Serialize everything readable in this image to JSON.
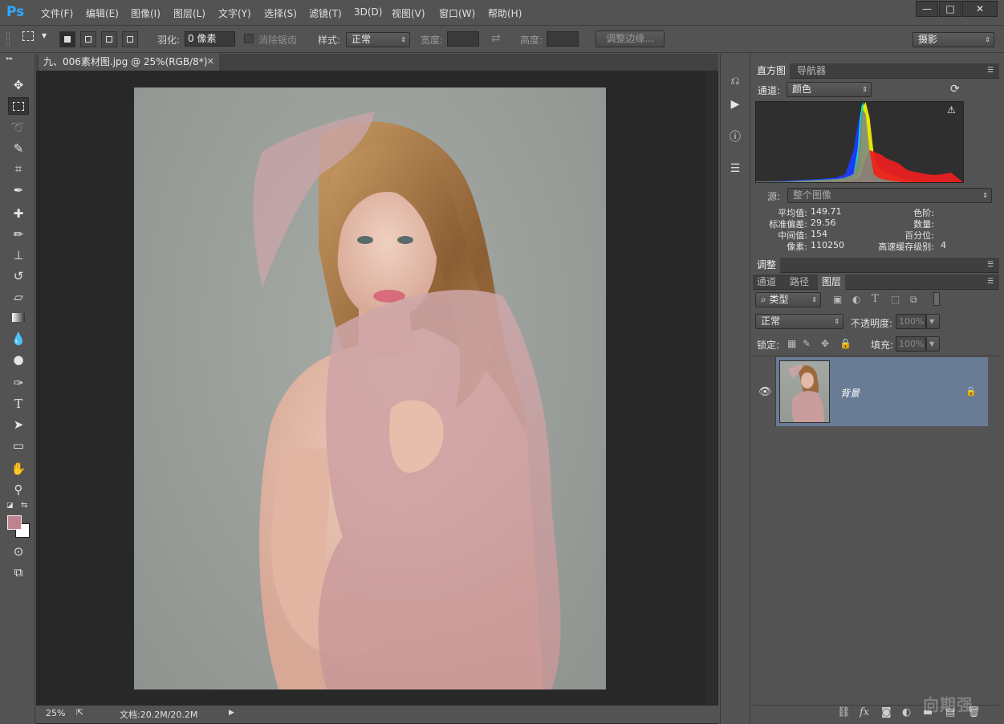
{
  "app": {
    "logo": "Ps"
  },
  "menu": [
    "文件(F)",
    "编辑(E)",
    "图像(I)",
    "图层(L)",
    "文字(Y)",
    "选择(S)",
    "滤镜(T)",
    "3D(D)",
    "视图(V)",
    "窗口(W)",
    "帮助(H)"
  ],
  "window_controls": {
    "minimize": "—",
    "maximize": "□",
    "close": "✕"
  },
  "options": {
    "feather_label": "羽化:",
    "feather_value": "0 像素",
    "antialias_label": "消除锯齿",
    "style_label": "样式:",
    "style_value": "正常",
    "width_label": "宽度:",
    "height_label": "高度:",
    "refine_edge": "调整边缘...",
    "workspace": "摄影"
  },
  "document": {
    "tab_title": "九、006素材图.jpg @ 25%(RGB/8*)",
    "zoom": "25%",
    "doc_size": "文档:20.2M/20.2M"
  },
  "colors": {
    "foreground": "#c1828f",
    "background": "#ffffff",
    "layer_selected": "#6a7b96"
  },
  "histogram": {
    "tabs": [
      "直方图",
      "导航器"
    ],
    "channel_label": "通道:",
    "channel_value": "颜色",
    "source_label": "源:",
    "source_value": "整个图像",
    "stats_left": [
      {
        "label": "平均值:",
        "value": "149.71"
      },
      {
        "label": "标准偏差:",
        "value": "29.56"
      },
      {
        "label": "中间值:",
        "value": "154"
      },
      {
        "label": "像素:",
        "value": "110250"
      }
    ],
    "stats_right": [
      {
        "label": "色阶:",
        "value": ""
      },
      {
        "label": "数量:",
        "value": ""
      },
      {
        "label": "百分位:",
        "value": ""
      },
      {
        "label": "高速缓存级别:",
        "value": "4"
      }
    ]
  },
  "adjustments": {
    "tab": "调整"
  },
  "layers_panel": {
    "tabs": [
      "通道",
      "路径",
      "图层"
    ],
    "filter_value": "类型",
    "blend_value": "正常",
    "opacity_label": "不透明度:",
    "opacity_value": "100%",
    "lock_label": "锁定:",
    "fill_label": "填充:",
    "fill_value": "100%",
    "layer_name": "背景"
  },
  "watermark": "向期强",
  "chart_data": {
    "type": "area",
    "title": "",
    "xlabel": "",
    "ylabel": "",
    "xlim": [
      0,
      255
    ],
    "ylim": [
      0,
      100
    ],
    "x": [
      0,
      20,
      40,
      60,
      80,
      100,
      110,
      120,
      125,
      128,
      130,
      132,
      135,
      140,
      145,
      150,
      155,
      160,
      165,
      170,
      175,
      180,
      185,
      190,
      195,
      200,
      210,
      220,
      230,
      240,
      250,
      255
    ],
    "series": [
      {
        "color": "#1a3cff",
        "values": [
          1,
          1,
          2,
          3,
          4,
          6,
          10,
          40,
          70,
          85,
          90,
          75,
          20,
          8,
          5,
          4,
          3,
          2,
          2,
          1,
          1,
          1,
          1,
          0,
          0,
          0,
          0,
          0,
          0,
          0,
          0,
          0
        ]
      },
      {
        "color": "#00e6e6",
        "values": [
          0,
          0,
          1,
          2,
          3,
          4,
          5,
          10,
          40,
          80,
          95,
          100,
          70,
          15,
          6,
          4,
          3,
          2,
          1,
          1,
          1,
          0,
          0,
          0,
          0,
          0,
          0,
          0,
          0,
          0,
          0,
          0
        ]
      },
      {
        "color": "#35c435",
        "values": [
          0,
          0,
          1,
          1,
          2,
          3,
          4,
          8,
          20,
          50,
          85,
          95,
          88,
          40,
          10,
          6,
          4,
          3,
          2,
          1,
          1,
          0,
          0,
          0,
          0,
          0,
          0,
          0,
          0,
          0,
          0,
          0
        ]
      },
      {
        "color": "#f0f000",
        "values": [
          0,
          0,
          0,
          1,
          1,
          2,
          3,
          5,
          10,
          20,
          50,
          95,
          100,
          80,
          35,
          20,
          15,
          12,
          10,
          8,
          6,
          4,
          3,
          2,
          1,
          1,
          0,
          0,
          0,
          0,
          0,
          0
        ]
      },
      {
        "color": "#e82020",
        "values": [
          0,
          0,
          0,
          0,
          1,
          1,
          2,
          3,
          5,
          8,
          12,
          20,
          30,
          40,
          38,
          36,
          34,
          30,
          28,
          26,
          24,
          20,
          16,
          14,
          13,
          12,
          10,
          9,
          10,
          12,
          4,
          0
        ]
      },
      {
        "color": "#808a80",
        "values": [
          1,
          1,
          1,
          2,
          3,
          4,
          6,
          10,
          30,
          60,
          85,
          90,
          85,
          38,
          10,
          6,
          4,
          3,
          2,
          1,
          1,
          0,
          0,
          0,
          0,
          0,
          0,
          0,
          0,
          0,
          0,
          0
        ]
      }
    ],
    "grid": false,
    "legend": "none"
  }
}
